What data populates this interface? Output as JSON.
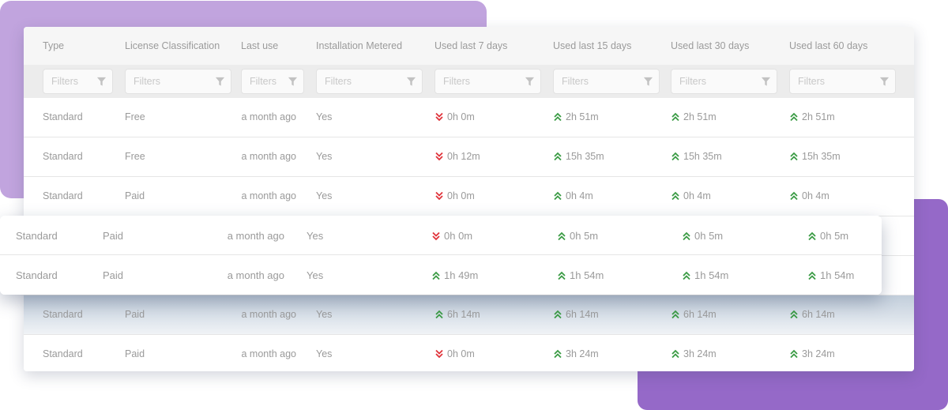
{
  "colors": {
    "accent_light": "#c1a4de",
    "accent_dark": "#9569c8",
    "trend_up": "#3a9b44",
    "trend_down": "#e0323a",
    "text_muted": "#9a9a9a"
  },
  "table": {
    "columns": [
      {
        "key": "type",
        "label": "Type"
      },
      {
        "key": "license",
        "label": "License Classification"
      },
      {
        "key": "last_use",
        "label": "Last use"
      },
      {
        "key": "metered",
        "label": "Installation Metered"
      },
      {
        "key": "d7",
        "label": "Used last 7 days"
      },
      {
        "key": "d15",
        "label": "Used last 15 days"
      },
      {
        "key": "d30",
        "label": "Used last 30 days"
      },
      {
        "key": "d60",
        "label": "Used last 60 days"
      }
    ],
    "filter_placeholder": "Filters",
    "filter_icon": "funnel-icon",
    "rows": [
      {
        "type": "Standard",
        "license": "Free",
        "last_use": "a month ago",
        "metered": "Yes",
        "d7": {
          "value": "0h 0m",
          "trend": "down"
        },
        "d15": {
          "value": "2h 51m",
          "trend": "up"
        },
        "d30": {
          "value": "2h 51m",
          "trend": "up"
        },
        "d60": {
          "value": "2h 51m",
          "trend": "up"
        }
      },
      {
        "type": "Standard",
        "license": "Free",
        "last_use": "a month ago",
        "metered": "Yes",
        "d7": {
          "value": "0h 12m",
          "trend": "down"
        },
        "d15": {
          "value": "15h 35m",
          "trend": "up"
        },
        "d30": {
          "value": "15h 35m",
          "trend": "up"
        },
        "d60": {
          "value": "15h 35m",
          "trend": "up"
        }
      },
      {
        "type": "Standard",
        "license": "Paid",
        "last_use": "a month ago",
        "metered": "Yes",
        "d7": {
          "value": "0h 0m",
          "trend": "down"
        },
        "d15": {
          "value": "0h 4m",
          "trend": "up"
        },
        "d30": {
          "value": "0h 4m",
          "trend": "up"
        },
        "d60": {
          "value": "0h 4m",
          "trend": "up"
        }
      },
      {
        "type": "Standard",
        "license": "Paid",
        "last_use": "a month ago",
        "metered": "Yes",
        "d7": {
          "value": "0h 0m",
          "trend": "down"
        },
        "d15": {
          "value": "0h 5m",
          "trend": "up"
        },
        "d30": {
          "value": "0h 5m",
          "trend": "up"
        },
        "d60": {
          "value": "0h 5m",
          "trend": "up"
        }
      },
      {
        "type": "Standard",
        "license": "Paid",
        "last_use": "a month ago",
        "metered": "Yes",
        "d7": {
          "value": "1h 49m",
          "trend": "up"
        },
        "d15": {
          "value": "1h 54m",
          "trend": "up"
        },
        "d30": {
          "value": "1h 54m",
          "trend": "up"
        },
        "d60": {
          "value": "1h 54m",
          "trend": "up"
        }
      },
      {
        "type": "Standard",
        "license": "Paid",
        "last_use": "a month ago",
        "metered": "Yes",
        "d7": {
          "value": "6h 14m",
          "trend": "up"
        },
        "d15": {
          "value": "6h 14m",
          "trend": "up"
        },
        "d30": {
          "value": "6h 14m",
          "trend": "up"
        },
        "d60": {
          "value": "6h 14m",
          "trend": "up"
        }
      },
      {
        "type": "Standard",
        "license": "Paid",
        "last_use": "a month ago",
        "metered": "Yes",
        "d7": {
          "value": "0h 0m",
          "trend": "down"
        },
        "d15": {
          "value": "3h 24m",
          "trend": "up"
        },
        "d30": {
          "value": "3h 24m",
          "trend": "up"
        },
        "d60": {
          "value": "3h 24m",
          "trend": "up"
        }
      }
    ]
  }
}
